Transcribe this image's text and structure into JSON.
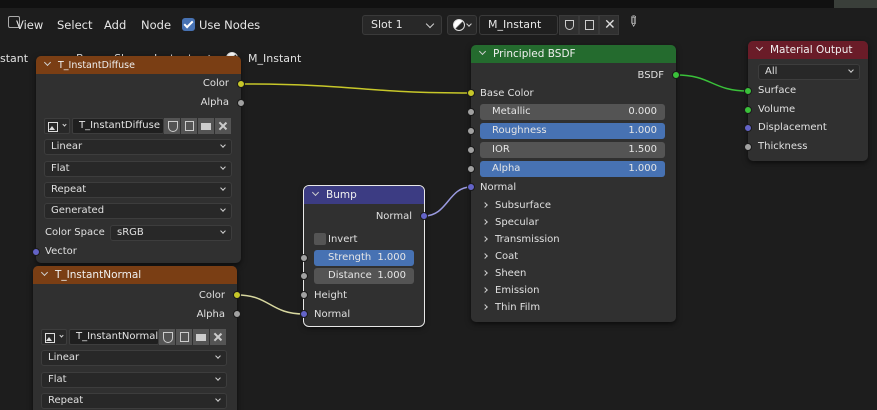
{
  "header": {
    "menu": [
      "View",
      "Select",
      "Add",
      "Node"
    ],
    "use_nodes_label": "Use Nodes",
    "use_nodes_checked": true,
    "slot": "Slot 1",
    "material_name": "M_Instant"
  },
  "breadcrumb": {
    "left_fragment": "stant",
    "object": "BronzeSheep_Instant",
    "material": "M_Instant"
  },
  "nodes": {
    "diffuse": {
      "title": "T_InstantDiffuse",
      "outputs": [
        "Color",
        "Alpha"
      ],
      "image_name": "T_InstantDiffuse",
      "selects": [
        "Linear",
        "Flat",
        "Repeat",
        "Generated"
      ],
      "color_space_label": "Color Space",
      "color_space": "sRGB",
      "input": "Vector",
      "header_color": "#7a3e14"
    },
    "normal": {
      "title": "T_InstantNormal",
      "outputs": [
        "Color",
        "Alpha"
      ],
      "image_name": "T_InstantNormal",
      "selects": [
        "Linear",
        "Flat",
        "Repeat"
      ],
      "header_color": "#7a3e14"
    },
    "bump": {
      "title": "Bump",
      "output": "Normal",
      "invert_label": "Invert",
      "strength_label": "Strength",
      "strength": "1.000",
      "distance_label": "Distance",
      "distance": "1.000",
      "inputs": [
        "Height",
        "Normal"
      ],
      "header_color": "#3c3c83"
    },
    "bsdf": {
      "title": "Principled BSDF",
      "output": "BSDF",
      "base_color": "Base Color",
      "fields": [
        {
          "label": "Metallic",
          "value": "0.000"
        },
        {
          "label": "Roughness",
          "value": "1.000"
        },
        {
          "label": "IOR",
          "value": "1.500"
        },
        {
          "label": "Alpha",
          "value": "1.000"
        }
      ],
      "normal": "Normal",
      "panels": [
        "Subsurface",
        "Specular",
        "Transmission",
        "Coat",
        "Sheen",
        "Emission",
        "Thin Film"
      ],
      "header_color": "#246283"
    },
    "output": {
      "title": "Material Output",
      "target": "All",
      "inputs": [
        "Surface",
        "Volume",
        "Displacement",
        "Thickness"
      ],
      "header_color": "#6a1c28"
    }
  },
  "colors": {
    "accent_blue": "#4772b3",
    "socket_yellow": "#c7c729",
    "socket_grey": "#a1a1a1",
    "socket_purple": "#6363c7",
    "socket_green": "#3ac13a",
    "bsdf_header": "#246b2e"
  }
}
